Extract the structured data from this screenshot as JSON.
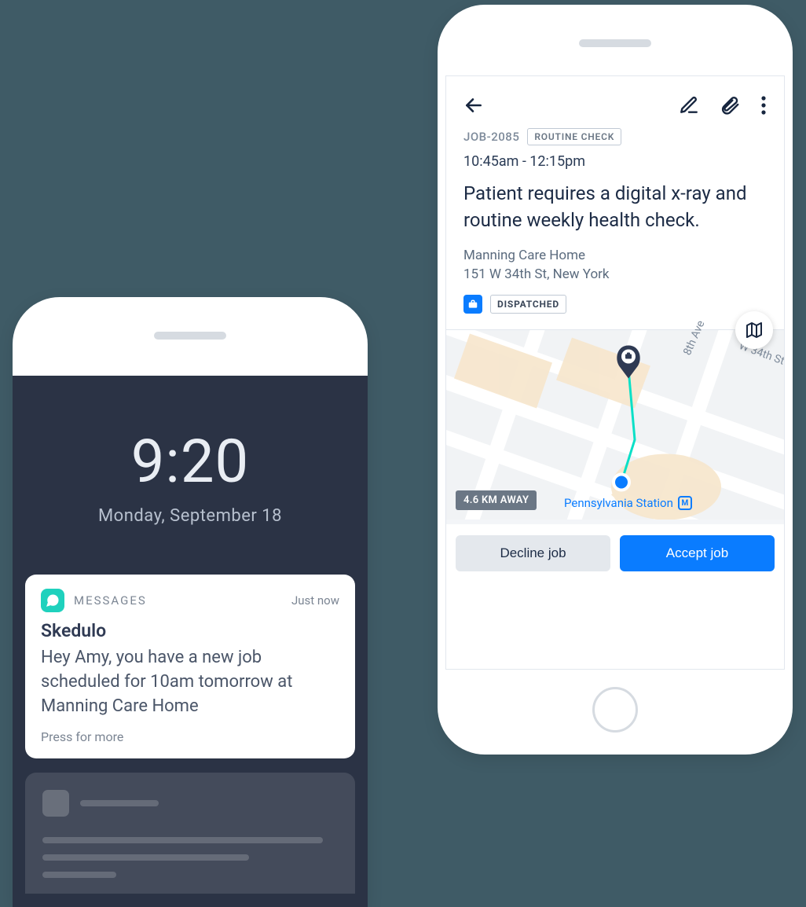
{
  "lockscreen": {
    "time": "9:20",
    "date": "Monday, September 18",
    "notification": {
      "app_label": "MESSAGES",
      "timestamp": "Just now",
      "title": "Skedulo",
      "body": "Hey Amy, you have a new job scheduled for 10am tomorrow at Manning Care Home",
      "press_more": "Press for more"
    }
  },
  "job": {
    "id": "JOB-2085",
    "type_tag": "ROUTINE CHECK",
    "time_range": "10:45am - 12:15pm",
    "description": "Patient requires a digital x-ray and routine weekly health check.",
    "location_name": "Manning Care Home",
    "location_address": "151 W 34th St, New York",
    "status_tag": "DISPATCHED",
    "distance_label": "4.6 KM AWAY",
    "map_poi": "Pennsylvania Station",
    "streets": {
      "a": "8th Ave",
      "b": "W 34th St"
    },
    "buttons": {
      "decline": "Decline job",
      "accept": "Accept job"
    }
  }
}
